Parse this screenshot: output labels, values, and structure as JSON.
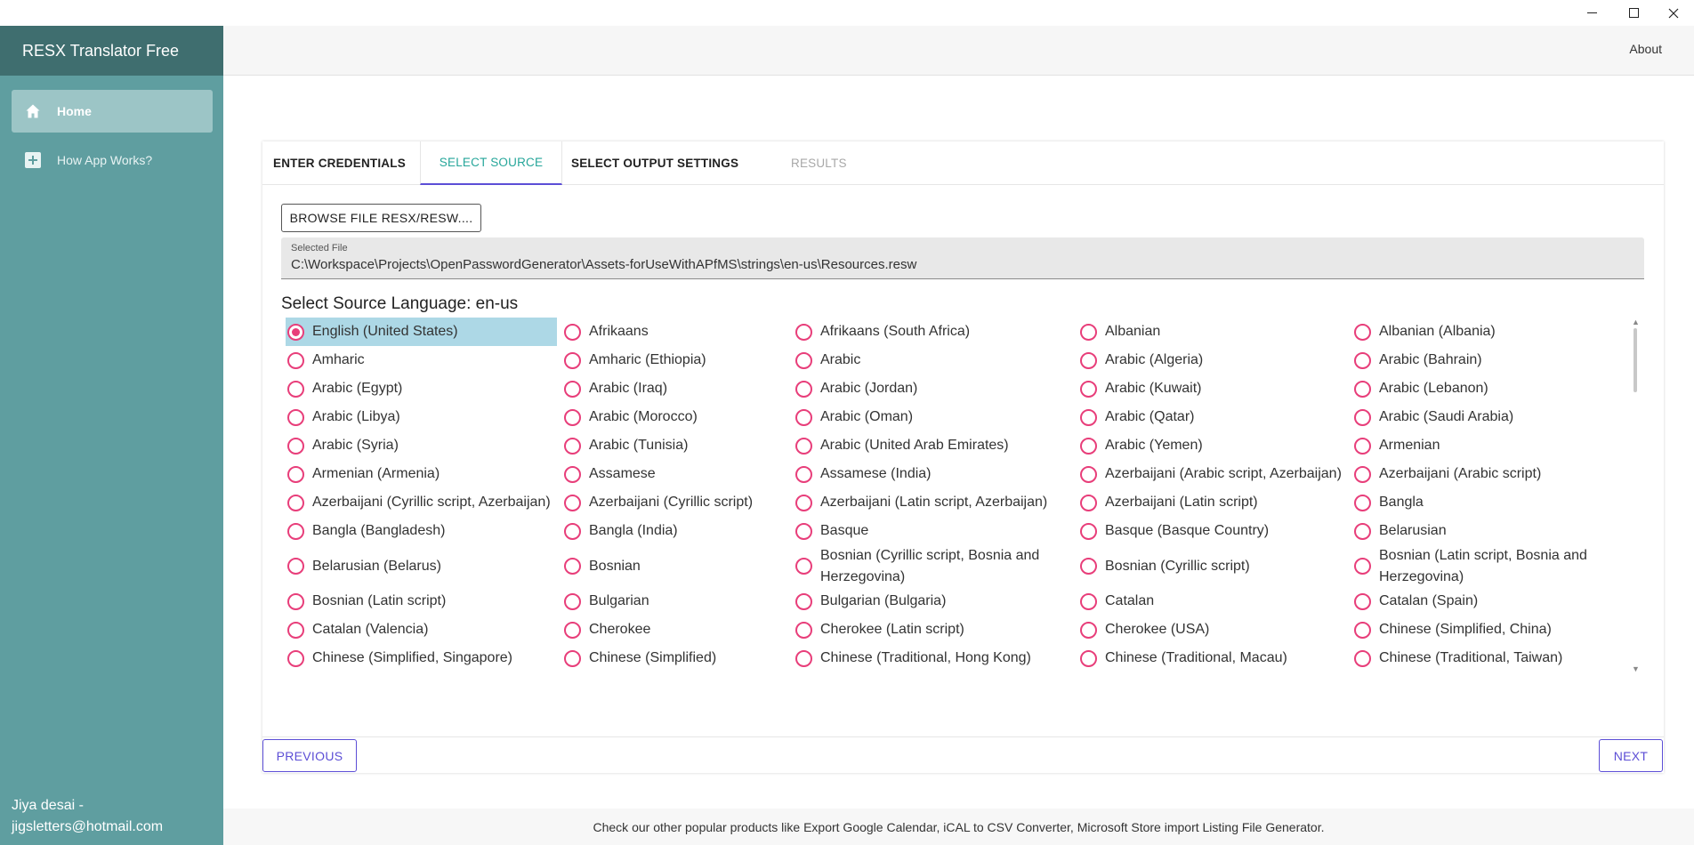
{
  "window": {
    "controls": [
      "minimize-icon",
      "maximize-icon",
      "close-icon"
    ]
  },
  "sidebar": {
    "app_title": "RESX Translator Free",
    "items": [
      {
        "label": "Home",
        "icon": "home-icon",
        "active": true
      },
      {
        "label": "How App Works?",
        "icon": "plus-box-icon",
        "active": false
      }
    ],
    "user_name": "Jiya desai -",
    "user_email": "jigsletters@hotmail.com",
    "bg_color": "#5f9ea0",
    "header_color": "#3f6e6f"
  },
  "appbar": {
    "about_label": "About"
  },
  "tabs": [
    {
      "label": "ENTER CREDENTIALS",
      "state": "done"
    },
    {
      "label": "SELECT SOURCE",
      "state": "active"
    },
    {
      "label": "SELECT OUTPUT SETTINGS",
      "state": "pending"
    },
    {
      "label": "RESULTS",
      "state": "disabled"
    }
  ],
  "browse_button": "BROWSE FILE RESX/RESW....",
  "selected_file": {
    "label": "Selected File",
    "value": "C:\\Workspace\\Projects\\OpenPasswordGenerator\\Assets-forUseWithAPfMS\\strings\\en-us\\Resources.resw"
  },
  "source_heading": "Select Source Language: en-us",
  "languages": {
    "selected": "English (United States)",
    "rows": [
      [
        "English (United States)",
        "Afrikaans",
        "Afrikaans (South Africa)",
        "Albanian",
        "Albanian (Albania)"
      ],
      [
        "Amharic",
        "Amharic (Ethiopia)",
        "Arabic",
        "Arabic (Algeria)",
        "Arabic (Bahrain)"
      ],
      [
        "Arabic (Egypt)",
        "Arabic (Iraq)",
        "Arabic (Jordan)",
        "Arabic (Kuwait)",
        "Arabic (Lebanon)"
      ],
      [
        "Arabic (Libya)",
        "Arabic (Morocco)",
        "Arabic (Oman)",
        "Arabic (Qatar)",
        "Arabic (Saudi Arabia)"
      ],
      [
        "Arabic (Syria)",
        "Arabic (Tunisia)",
        "Arabic (United Arab Emirates)",
        "Arabic (Yemen)",
        "Armenian"
      ],
      [
        "Armenian (Armenia)",
        "Assamese",
        "Assamese (India)",
        "Azerbaijani (Arabic script, Azerbaijan)",
        "Azerbaijani (Arabic script)"
      ],
      [
        "Azerbaijani (Cyrillic script, Azerbaijan)",
        "Azerbaijani (Cyrillic script)",
        "Azerbaijani (Latin script, Azerbaijan)",
        "Azerbaijani (Latin script)",
        "Bangla"
      ],
      [
        "Bangla (Bangladesh)",
        "Bangla (India)",
        "Basque",
        "Basque (Basque Country)",
        "Belarusian"
      ],
      [
        "Belarusian (Belarus)",
        "Bosnian",
        "Bosnian (Cyrillic script, Bosnia and Herzegovina)",
        "Bosnian (Cyrillic script)",
        "Bosnian (Latin script, Bosnia and Herzegovina)"
      ],
      [
        "Bosnian (Latin script)",
        "Bulgarian",
        "Bulgarian (Bulgaria)",
        "Catalan",
        "Catalan (Spain)"
      ],
      [
        "Catalan (Valencia)",
        "Cherokee",
        "Cherokee (Latin script)",
        "Cherokee (USA)",
        "Chinese (Simplified, China)"
      ],
      [
        "Chinese (Simplified, Singapore)",
        "Chinese (Simplified)",
        "Chinese (Traditional, Hong Kong)",
        "Chinese (Traditional, Macau)",
        "Chinese (Traditional, Taiwan)"
      ]
    ],
    "radio_color": "#e83e7a",
    "selected_bg": "#add8e6"
  },
  "buttons": {
    "previous": "PREVIOUS",
    "next": "NEXT",
    "accent": "#5c4ed6"
  },
  "footer_text": "Check our other popular products like Export Google Calendar, iCAL to CSV Converter, Microsoft Store import Listing File Generator."
}
